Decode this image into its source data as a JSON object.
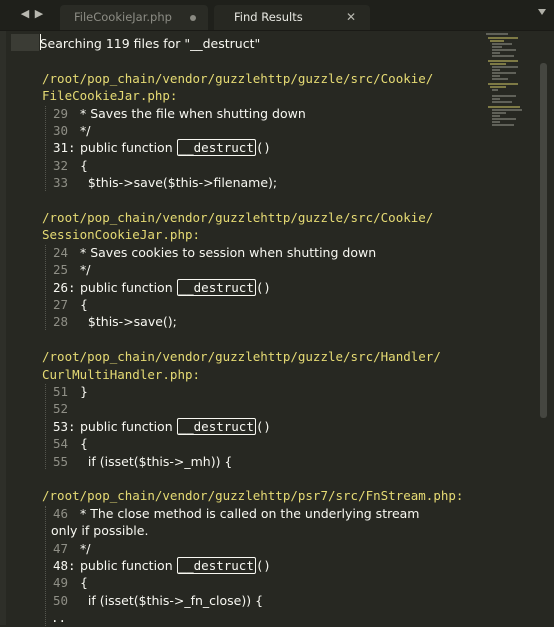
{
  "tabs": [
    {
      "label": "FileCookieJar.php",
      "modified": true
    },
    {
      "label": "Find Results",
      "active": true
    }
  ],
  "nav": {
    "back": "◀",
    "forward": "▶",
    "close": "✕"
  },
  "summary": {
    "cursor_char": "S",
    "rest": "earching 119 files for \"__destruct\""
  },
  "blocks": [
    {
      "path1": "/root/pop_chain/vendor/guzzlehttp/guzzle/src/Cookie/",
      "path2": "FileCookieJar.php:",
      "lines": [
        {
          "num": "29",
          "colon": "",
          "pre": " * Saves the file when shutting down"
        },
        {
          "num": "30",
          "colon": "",
          "pre": " */"
        },
        {
          "num": "31",
          "colon": ":",
          "pre": " public function ",
          "match": "__destruct",
          "post": "()"
        },
        {
          "num": "32",
          "colon": "",
          "pre": " {"
        },
        {
          "num": "33",
          "colon": "",
          "pre": "   $this->save($this->filename);"
        }
      ]
    },
    {
      "path1": "/root/pop_chain/vendor/guzzlehttp/guzzle/src/Cookie/",
      "path2": "SessionCookieJar.php:",
      "lines": [
        {
          "num": "24",
          "colon": "",
          "pre": " * Saves cookies to session when shutting down"
        },
        {
          "num": "25",
          "colon": "",
          "pre": " */"
        },
        {
          "num": "26",
          "colon": ":",
          "pre": " public function ",
          "match": "__destruct",
          "post": "()"
        },
        {
          "num": "27",
          "colon": "",
          "pre": " {"
        },
        {
          "num": "28",
          "colon": "",
          "pre": "   $this->save();"
        }
      ]
    },
    {
      "path1": "/root/pop_chain/vendor/guzzlehttp/guzzle/src/Handler/",
      "path2": "CurlMultiHandler.php:",
      "lines": [
        {
          "num": "51",
          "colon": "",
          "pre": " }"
        },
        {
          "num": "52",
          "colon": "",
          "pre": ""
        },
        {
          "num": "53",
          "colon": ":",
          "pre": " public function ",
          "match": "__destruct",
          "post": "()"
        },
        {
          "num": "54",
          "colon": "",
          "pre": " {"
        },
        {
          "num": "55",
          "colon": "",
          "pre": "   if (isset($this->_mh)) {"
        }
      ]
    },
    {
      "path1": "/root/pop_chain/vendor/guzzlehttp/psr7/src/FnStream.php:",
      "path2": "",
      "lines": [
        {
          "num": "46",
          "colon": "",
          "pre": " * The close method is called on the underlying stream"
        },
        {
          "num": "",
          "colon": "",
          "pre": "only if possible.",
          "wrap": true
        },
        {
          "num": "47",
          "colon": "",
          "pre": " */"
        },
        {
          "num": "48",
          "colon": ":",
          "pre": " public function ",
          "match": "__destruct",
          "post": "()"
        },
        {
          "num": "49",
          "colon": "",
          "pre": " {"
        },
        {
          "num": "50",
          "colon": "",
          "pre": "   if (isset($this->_fn_close)) {"
        },
        {
          "num": "",
          "colon": "",
          "pre": "..",
          "ellipsis": true
        }
      ]
    }
  ],
  "colors": {
    "background": "#272822",
    "path": "#e6db74",
    "line_number": "#8f8f86",
    "text": "#f8f8f2"
  }
}
